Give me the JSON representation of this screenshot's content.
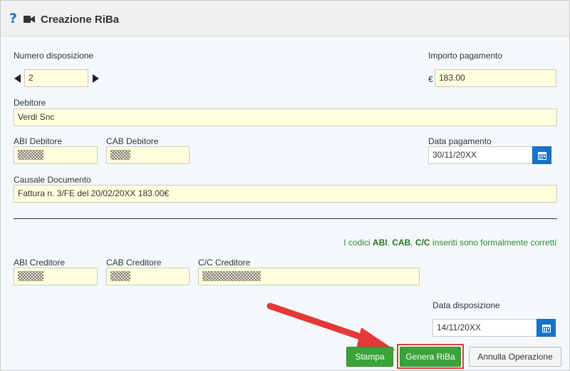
{
  "window": {
    "title": "Creazione RiBa",
    "help_icon": "?",
    "camera_icon": "video-camera-icon"
  },
  "form": {
    "numero_disposizione": {
      "label": "Numero disposizione",
      "value": "2"
    },
    "importo_pagamento": {
      "label": "Importo pagamento",
      "currency": "€",
      "value": "183.00"
    },
    "debitore": {
      "label": "Debitore",
      "value": "Verdi Snc"
    },
    "abi_debitore": {
      "label": "ABI Debitore"
    },
    "cab_debitore": {
      "label": "CAB Debitore"
    },
    "data_pagamento": {
      "label": "Data pagamento",
      "value": "30/11/20XX"
    },
    "causale_documento": {
      "label": "Causale Documento",
      "value": "Fattura n. 3/FE del 20/02/20XX 183.00€"
    },
    "validation": {
      "prefix": "I codici ",
      "abi": "ABI",
      "sep1": ", ",
      "cab": "CAB",
      "sep2": ", ",
      "cc": "C/C",
      "suffix": " inseriti sono formalmente corretti"
    },
    "abi_creditore": {
      "label": "ABI Creditore"
    },
    "cab_creditore": {
      "label": "CAB Creditore"
    },
    "cc_creditore": {
      "label": "C/C Creditore"
    },
    "data_disposizione": {
      "label": "Data disposizione",
      "value": "14/11/20XX"
    }
  },
  "buttons": {
    "stampa": "Stampa",
    "genera_riba": "Genera RiBa",
    "annulla": "Annulla Operazione"
  },
  "colors": {
    "accent": "#1a73c9",
    "success": "#3aa33a",
    "field_bg": "#fffedd",
    "annotation": "#e53935"
  }
}
